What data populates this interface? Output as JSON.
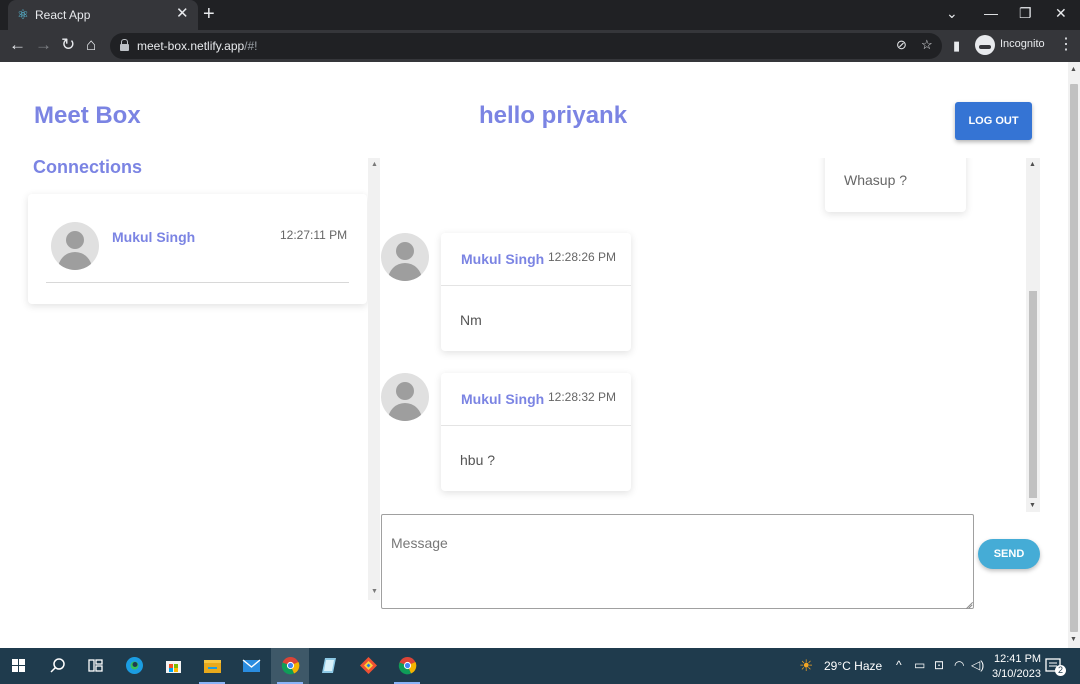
{
  "browser": {
    "tab_title": "React App",
    "tab_icon": "react-atom-icon",
    "url_host": "meet-box.netlify.app",
    "url_path": "/#!",
    "profile_label": "Incognito"
  },
  "header": {
    "app_title": "Meet Box",
    "greeting": "hello priyank",
    "logout_label": "LOG OUT"
  },
  "sidebar": {
    "title": "Connections",
    "connections": [
      {
        "name": "Mukul Singh",
        "time": "12:27:11 PM"
      }
    ]
  },
  "chat": {
    "own_message": "Whasup ?",
    "messages": [
      {
        "name": "Mukul Singh",
        "time": "12:28:26 PM",
        "text": "Nm"
      },
      {
        "name": "Mukul Singh",
        "time": "12:28:32 PM",
        "text": "hbu ?"
      }
    ],
    "input_placeholder": "Message",
    "send_label": "SEND"
  },
  "taskbar": {
    "weather": "29°C  Haze",
    "time": "12:41 PM",
    "date": "3/10/2023",
    "notification_count": "2"
  },
  "colors": {
    "accent": "#7b84e3",
    "logout": "#3574d4",
    "send": "#45acd6",
    "taskbar": "#1f3b4d"
  }
}
